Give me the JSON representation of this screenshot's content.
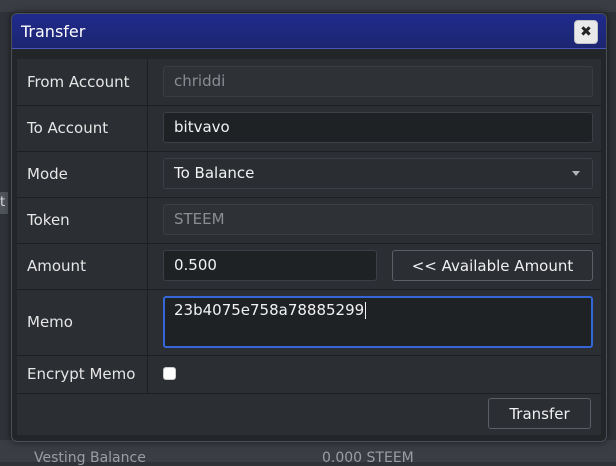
{
  "dialog": {
    "title": "Transfer",
    "close_icon": "close-icon"
  },
  "form": {
    "from_account": {
      "label": "From Account",
      "value": "chriddi"
    },
    "to_account": {
      "label": "To Account",
      "value": "bitvavo"
    },
    "mode": {
      "label": "Mode",
      "value": "To Balance"
    },
    "token": {
      "label": "Token",
      "value": "STEEM"
    },
    "amount": {
      "label": "Amount",
      "value": "0.500",
      "available_button": "<<  Available Amount"
    },
    "memo": {
      "label": "Memo",
      "value": "23b4075e758a78885299"
    },
    "encrypt_memo": {
      "label": "Encrypt Memo",
      "checked": false
    },
    "submit_label": "Transfer"
  },
  "background": {
    "partial_left_char": "t",
    "bottom_left": "Vesting Balance",
    "bottom_right": "0.000  STEEM"
  },
  "colors": {
    "titlebar": "#1c2670",
    "focus_border": "#3466d8",
    "dialog_bg": "#232629"
  }
}
